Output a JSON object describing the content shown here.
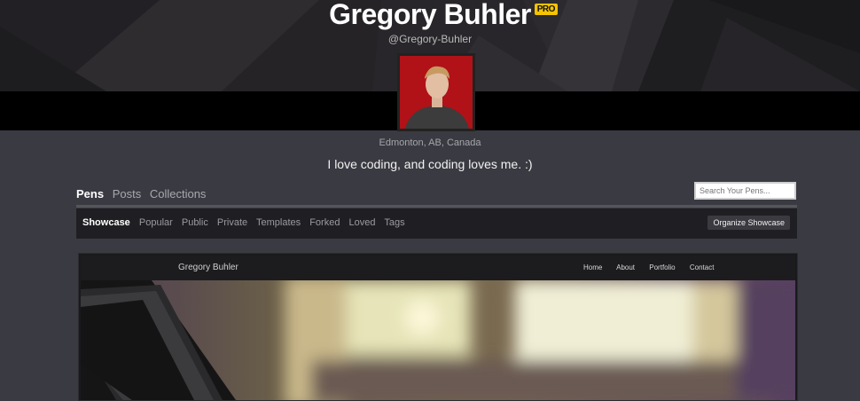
{
  "profile": {
    "name": "Gregory Buhler",
    "badge": "PRO",
    "handle": "@Gregory-Buhler",
    "location": "Edmonton, AB, Canada",
    "bio": "I love coding, and coding loves me. :)"
  },
  "tabs": [
    "Pens",
    "Posts",
    "Collections"
  ],
  "search": {
    "placeholder": "Search Your Pens..."
  },
  "subnav": {
    "items": [
      "Showcase",
      "Popular",
      "Public",
      "Private",
      "Templates",
      "Forked",
      "Loved",
      "Tags"
    ],
    "organize_label": "Organize Showcase"
  },
  "preview": {
    "brand": "Gregory Buhler",
    "links": [
      "Home",
      "About",
      "Portfolio",
      "Contact"
    ]
  }
}
